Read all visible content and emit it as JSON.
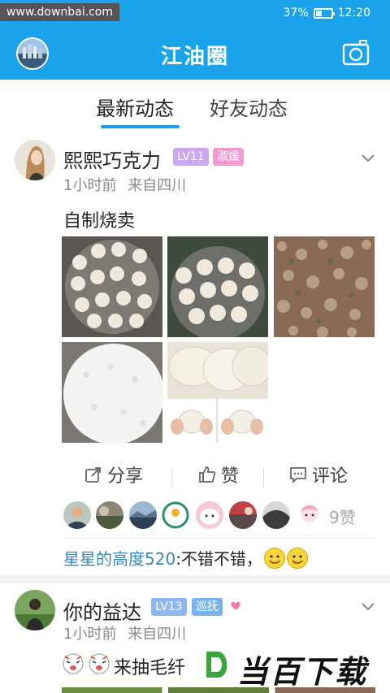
{
  "status_bar": {
    "watermark": "www.downbai.com",
    "battery": "37%",
    "battery_level": 0.37,
    "time": "12:20"
  },
  "header": {
    "title": "江油圈",
    "avatar_icon": "user-avatar",
    "camera_icon": "camera-icon"
  },
  "tabs": [
    {
      "label": "最新动态",
      "active": true
    },
    {
      "label": "好友动态",
      "active": false
    }
  ],
  "posts": [
    {
      "username": "熙熙巧克力",
      "level": "LV11",
      "title_badge": "淑媛",
      "time": "1小时前",
      "location": "来自四川",
      "text": "自制烧卖",
      "images": [
        "shaomai-steamer-1",
        "shaomai-steamer-2",
        "filling",
        "sticky-rice",
        "wrappers",
        "wrapping-shaomai"
      ],
      "actions": {
        "share": "分享",
        "like": "赞",
        "comment": "评论"
      },
      "likes_label": "9赞",
      "comment": {
        "user": "星星的高度520",
        "text": ":不错不错，"
      }
    },
    {
      "username": "你的益达",
      "level": "LV13",
      "title_badge": "巡抚",
      "time": "1小时前",
      "location": "来自四川",
      "text": "来抽毛纤"
    }
  ],
  "footer_logo": {
    "letter": "D",
    "text": "当百下载"
  },
  "colors": {
    "primary": "#1aa3ea",
    "level_badge_1": "#c9a7f2",
    "title_badge_1": "#f29ad0",
    "level_badge_2": "#8db7ef",
    "title_badge_2": "#76b4f0",
    "comment_user": "#3a87c5"
  }
}
